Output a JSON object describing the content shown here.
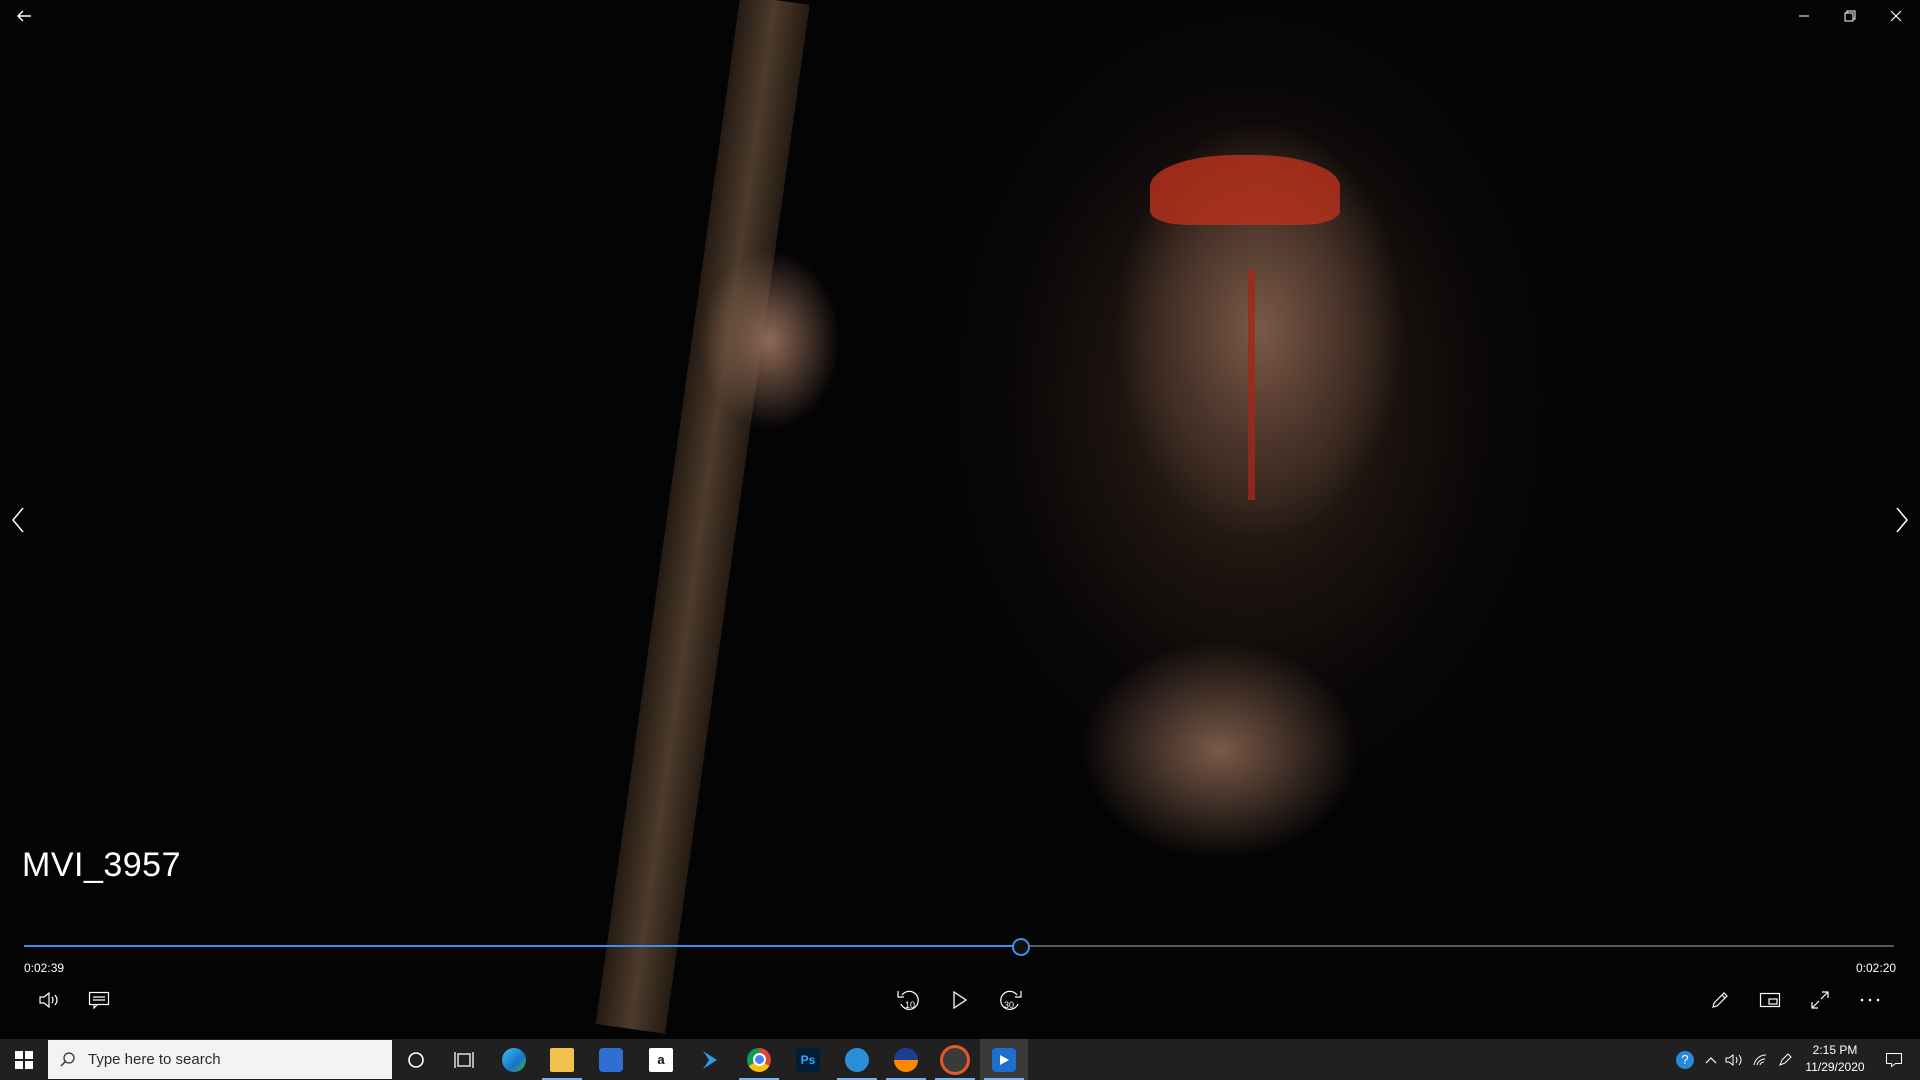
{
  "video": {
    "title": "MVI_3957",
    "elapsed": "0:02:39",
    "remaining": "0:02:20",
    "progress": 0.533,
    "skip_back_seconds": "10",
    "skip_forward_seconds": "30"
  },
  "colors": {
    "accent": "#3f8ff0",
    "taskbar": "#202020"
  },
  "taskbar": {
    "search_placeholder": "Type here to search",
    "time": "2:15 PM",
    "date": "11/29/2020",
    "apps": [
      "start-icon",
      "cortana-icon",
      "task-view-icon",
      "edge-icon",
      "file-explorer-icon",
      "store-icon",
      "amazon-icon",
      "visual-studio-icon",
      "chrome-icon",
      "photoshop-icon",
      "app-icon",
      "vlc-icon",
      "media-icon",
      "movies-tv-icon"
    ],
    "photoshop_label": "Ps",
    "amazon_label": "a"
  }
}
